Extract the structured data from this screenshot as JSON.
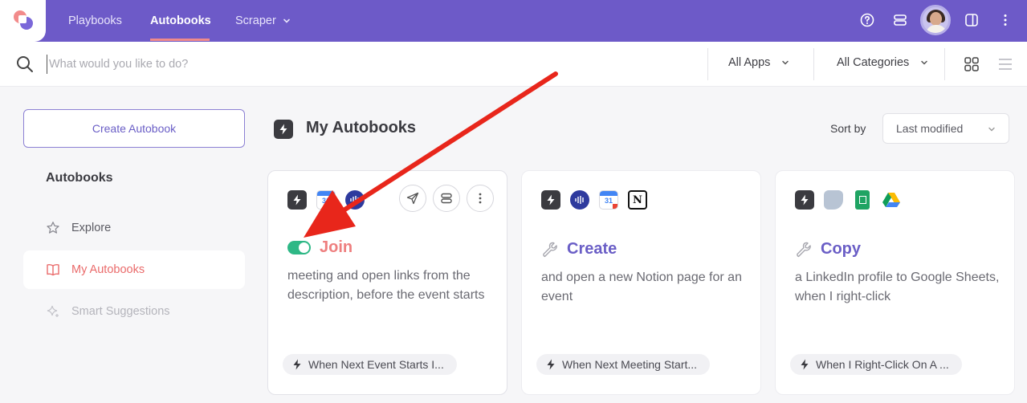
{
  "topbar": {
    "nav": [
      {
        "label": "Playbooks"
      },
      {
        "label": "Autobooks",
        "active": true
      },
      {
        "label": "Scraper"
      }
    ]
  },
  "search": {
    "placeholder": "What would you like to do?",
    "value": ""
  },
  "filters": {
    "apps": "All Apps",
    "categories": "All Categories"
  },
  "sidebar": {
    "create_label": "Create Autobook",
    "heading": "Autobooks",
    "items": [
      {
        "label": "Explore",
        "icon": "star-icon"
      },
      {
        "label": "My Autobooks",
        "icon": "book-icon",
        "active": true
      },
      {
        "label": "Smart Suggestions",
        "icon": "sparkle-icon",
        "disabled": true
      }
    ]
  },
  "main": {
    "title": "My Autobooks",
    "sort_label": "Sort by",
    "sort_value": "Last modified"
  },
  "cards": [
    {
      "title": "Join",
      "enabled": true,
      "description": "meeting and open links from the description, before the event starts",
      "trigger": "When Next Event Starts I...",
      "apps": [
        "bolt-icon",
        "google-calendar-icon",
        "otter-icon"
      ]
    },
    {
      "title": "Create",
      "description": "and open a new Notion page for an event",
      "trigger": "When Next Meeting Start...",
      "apps": [
        "bolt-icon",
        "otter-icon",
        "google-calendar-icon",
        "notion-icon"
      ]
    },
    {
      "title": "Copy",
      "description": "a LinkedIn profile to Google Sheets, when I right-click",
      "trigger": "When I Right-Click On A ...",
      "apps": [
        "bolt-icon",
        "note-icon",
        "google-sheets-icon",
        "google-drive-icon"
      ]
    }
  ],
  "colors": {
    "brand": "#6d5ac8",
    "accent": "#ea6b6b",
    "toggle_on": "#2eb886",
    "annotation_arrow": "#e8261b"
  }
}
